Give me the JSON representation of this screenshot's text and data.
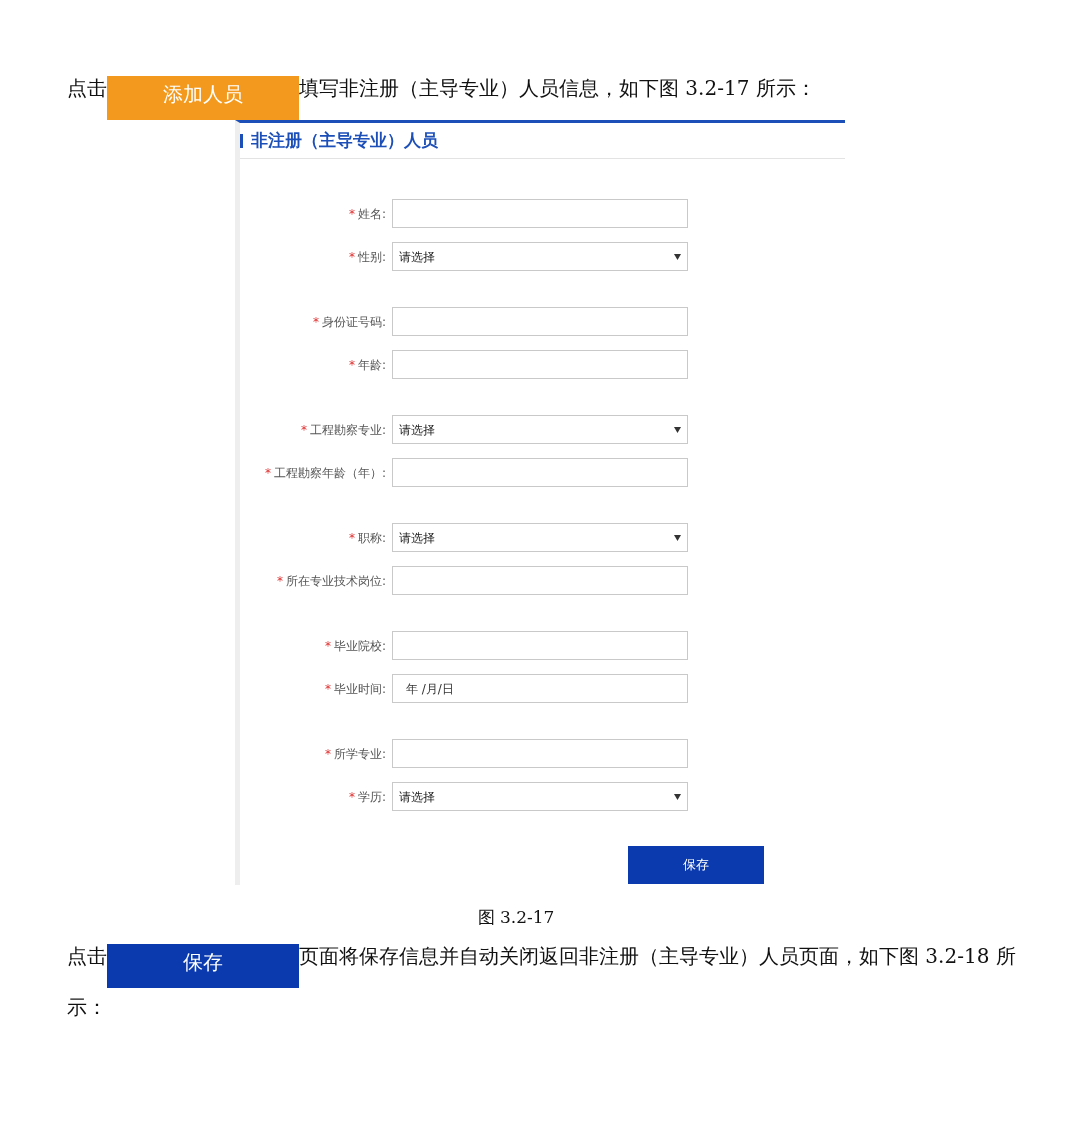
{
  "paragraphs": [
    {
      "before": "点击",
      "button": {
        "label": "添加人员",
        "color": "#f39a1e"
      },
      "after": "填写非注册（主导专业）人员信息，如下图 3.2-17 所示："
    },
    {
      "before": "点击",
      "button": {
        "label": "保存",
        "color": "#0a3aad"
      },
      "after": "页面将保存信息并自动关闭返回非注册（主导专业）人员页面，如下图 3.2-18 所示："
    }
  ],
  "figure": {
    "title": "非注册（主导专业）人员",
    "groups": [
      [
        {
          "required_mark": "*",
          "label": "姓名:",
          "kind": "text"
        },
        {
          "required_mark": "*",
          "label": "性别:",
          "kind": "select",
          "value": "请选择"
        }
      ],
      [
        {
          "required_mark": "*",
          "label": "身份证号码:",
          "kind": "text"
        },
        {
          "required_mark": "*",
          "label": "年龄:",
          "kind": "text"
        }
      ],
      [
        {
          "required_mark": "*",
          "label": "工程勘察专业:",
          "kind": "select",
          "value": "请选择"
        },
        {
          "required_mark": "*",
          "label": "工程勘察年龄（年）:",
          "kind": "text"
        }
      ],
      [
        {
          "required_mark": "*",
          "label": "职称:",
          "kind": "select",
          "value": "请选择"
        },
        {
          "required_mark": "*",
          "label": "所在专业技术岗位:",
          "kind": "text"
        }
      ],
      [
        {
          "required_mark": "*",
          "label": "毕业院校:",
          "kind": "text"
        },
        {
          "required_mark": "*",
          "label": "毕业时间:",
          "kind": "date",
          "placeholder": "年 /月/日"
        }
      ],
      [
        {
          "required_mark": "*",
          "label": "所学专业:",
          "kind": "text"
        },
        {
          "required_mark": "*",
          "label": "学历:",
          "kind": "select",
          "value": "请选择"
        }
      ]
    ],
    "save_button": "保存"
  },
  "caption": "图 3.2-17"
}
